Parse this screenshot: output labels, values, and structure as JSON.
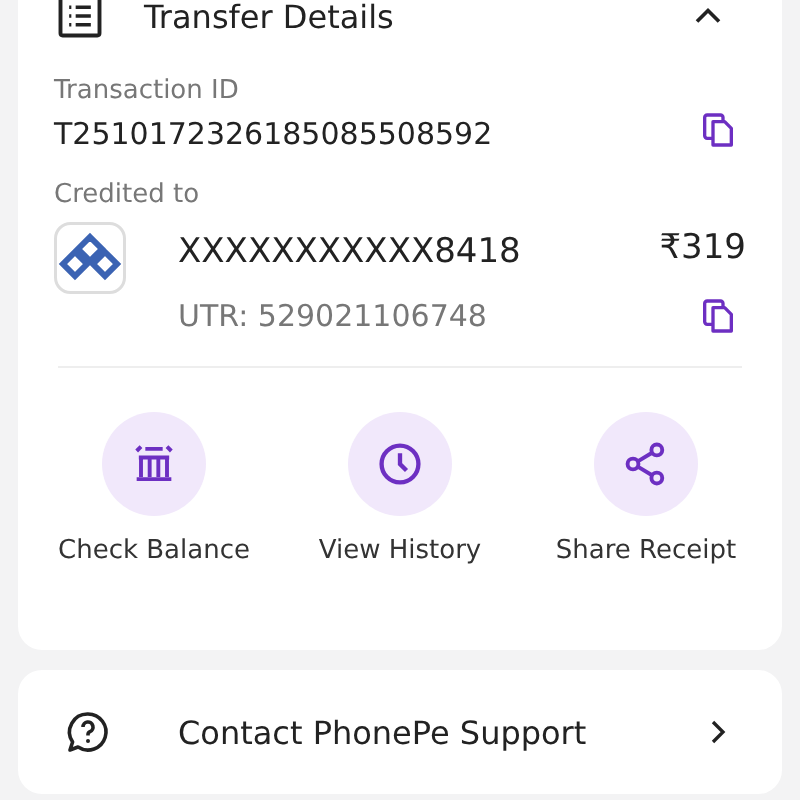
{
  "details_card": {
    "title": "Transfer Details",
    "expanded": true,
    "transaction_id": {
      "label": "Transaction ID",
      "value": "T2510172326185085508592"
    },
    "credited_to": {
      "label": "Credited to",
      "account": "XXXXXXXXXXX8418",
      "amount": "₹319",
      "utr": "UTR: 529021106748"
    },
    "actions": [
      {
        "kind": "balance",
        "label": "Check Balance"
      },
      {
        "kind": "history",
        "label": "View History"
      },
      {
        "kind": "share",
        "label": "Share Receipt"
      }
    ]
  },
  "support": {
    "label": "Contact PhonePe Support"
  }
}
